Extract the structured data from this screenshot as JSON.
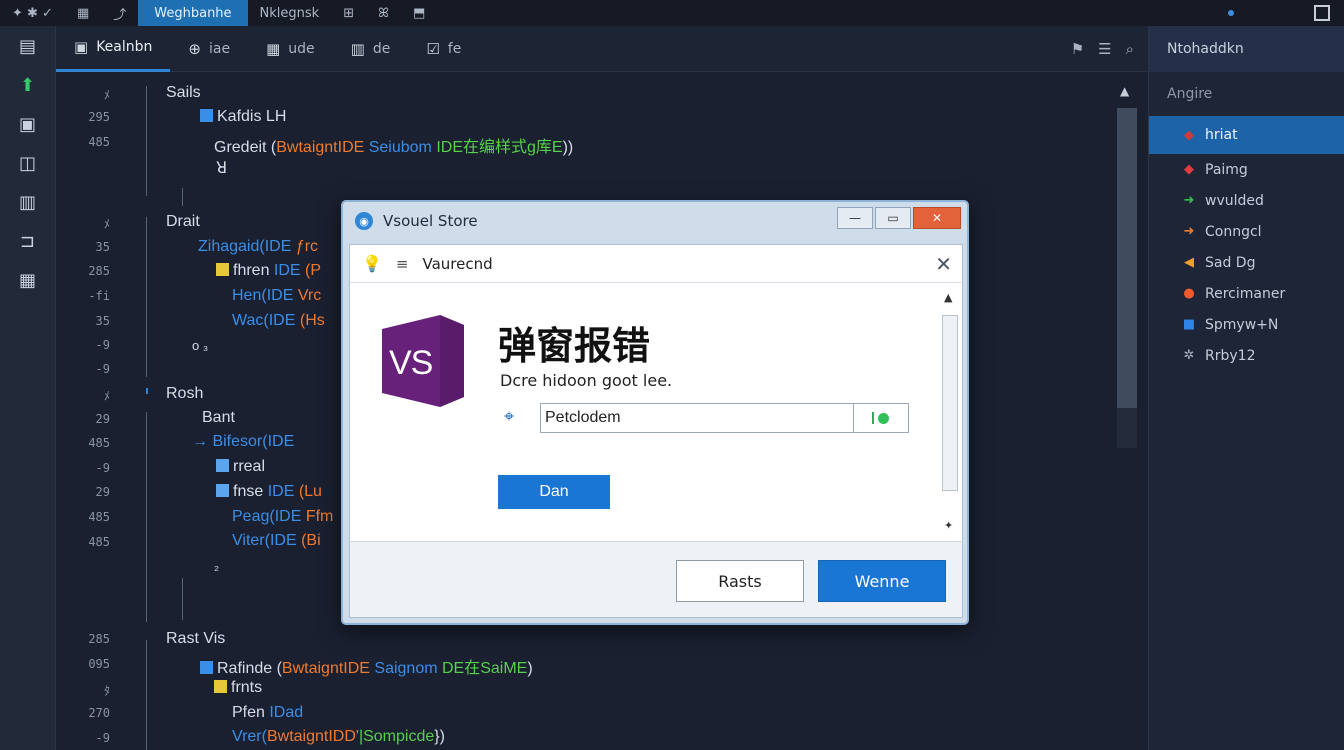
{
  "topbar": {
    "items": [
      "✦ ✱ ✓",
      "▦",
      "⤴",
      "Weghbanhe",
      "Nklegnsk",
      "⊞",
      "ꕤ",
      "⬒"
    ],
    "active_label": "Weghbanhe",
    "menu_label": "Nklegnsk"
  },
  "tabs": [
    {
      "label": "Kealnbn",
      "icon": "file-icon"
    },
    {
      "label": "iae",
      "icon": "globe-icon"
    },
    {
      "label": "ude",
      "icon": "grid-icon"
    },
    {
      "label": "de",
      "icon": "table-icon"
    },
    {
      "label": "fe",
      "icon": "check-icon"
    }
  ],
  "editor": {
    "line_numbers": [
      "ﾒ",
      "295",
      "485",
      "",
      "",
      "ﾒ",
      "35",
      "285",
      "-fi",
      "35",
      "-9",
      "-9",
      "ﾒ",
      "29",
      "485",
      "-9",
      "29",
      "485",
      "485",
      "",
      "",
      "",
      "285",
      "095",
      "ﾀ",
      "270",
      "-9"
    ],
    "lines": {
      "l1": "Sails",
      "l2": "Kafdis LH",
      "l3a": "Gredeit (",
      "l3b": "BwtaigntIDE ",
      "l3c": "Seiubom ",
      "l3d": "IDE在编样式g库E",
      "l3e": "))",
      "l4": "ꓤ",
      "l5": "Drait",
      "l6a": "Zihagaid(",
      "l6b": "IDE ",
      "l6c": "ƒrc",
      "l7a": "fhren ",
      "l7b": "IDE ",
      "l7c": "(P",
      "l8a": "Hen(",
      "l8b": "IDE ",
      "l8c": "Vrc",
      "l9a": "Wac(",
      "l9b": "IDE ",
      "l9c": "(Hs",
      "l10": "o  ₃",
      "l11": "Rosh",
      "l12": "Bant",
      "l13a": "Bifesor(",
      "l13b": "IDE",
      "l14": "rreal",
      "l15a": "fnse ",
      "l15b": "IDE ",
      "l15c": "(Lu",
      "l16a": "Peag(",
      "l16b": "IDE ",
      "l16c": "Ffm",
      "l17a": "Viter(",
      "l17b": "IDE ",
      "l17c": "(Bi",
      "l18": "₂",
      "l19": "Rast Vis",
      "l20a": "Rafinde (",
      "l20b": "BwtaigntIDE ",
      "l20c": "Saignom ",
      "l20d": "DE在SaiME",
      "l20e": ")",
      "l21": "frnts",
      "l22a": "Pfen ",
      "l22b": "IDad",
      "l23a": "Vrer(",
      "l23b": "BwtaigntIDD'",
      "l23c": "|Sompicde",
      "l23d": "})"
    }
  },
  "right_panel": {
    "header": "Ntohaddkn",
    "subheader": "Angire",
    "items": [
      {
        "label": "hriat",
        "icon": "pin-icon",
        "color": "#d23a3a",
        "selected": true
      },
      {
        "label": "Paimg",
        "icon": "pin-icon",
        "color": "#e23b3b"
      },
      {
        "label": "wvulded",
        "icon": "arrow-icon",
        "color": "#33c04a"
      },
      {
        "label": "Conngcl",
        "icon": "arrow-icon",
        "color": "#f07a2c"
      },
      {
        "label": "Sad Dg",
        "icon": "tag-icon",
        "color": "#f0a02c"
      },
      {
        "label": "Rercimaner",
        "icon": "dot-icon",
        "color": "#f05a2c"
      },
      {
        "label": "Spmyw+N",
        "icon": "square-icon",
        "color": "#2f84e8"
      },
      {
        "label": "Rrby12",
        "icon": "gear-icon",
        "color": "#a9b3c1"
      }
    ]
  },
  "dialog": {
    "title": "Vsouel Store",
    "toolbar_label": "Vaurecnd",
    "logo_text": "VS",
    "heading": "弹窗报错",
    "description": "Dcre hidoon goot lee.",
    "input_value": "Petclodem",
    "primary_action": "Dan",
    "cancel_label": "Rasts",
    "confirm_label": "Wenne",
    "colors": {
      "primary": "#1976d2",
      "close": "#e2623a",
      "vs_purple": "#68217a"
    }
  }
}
